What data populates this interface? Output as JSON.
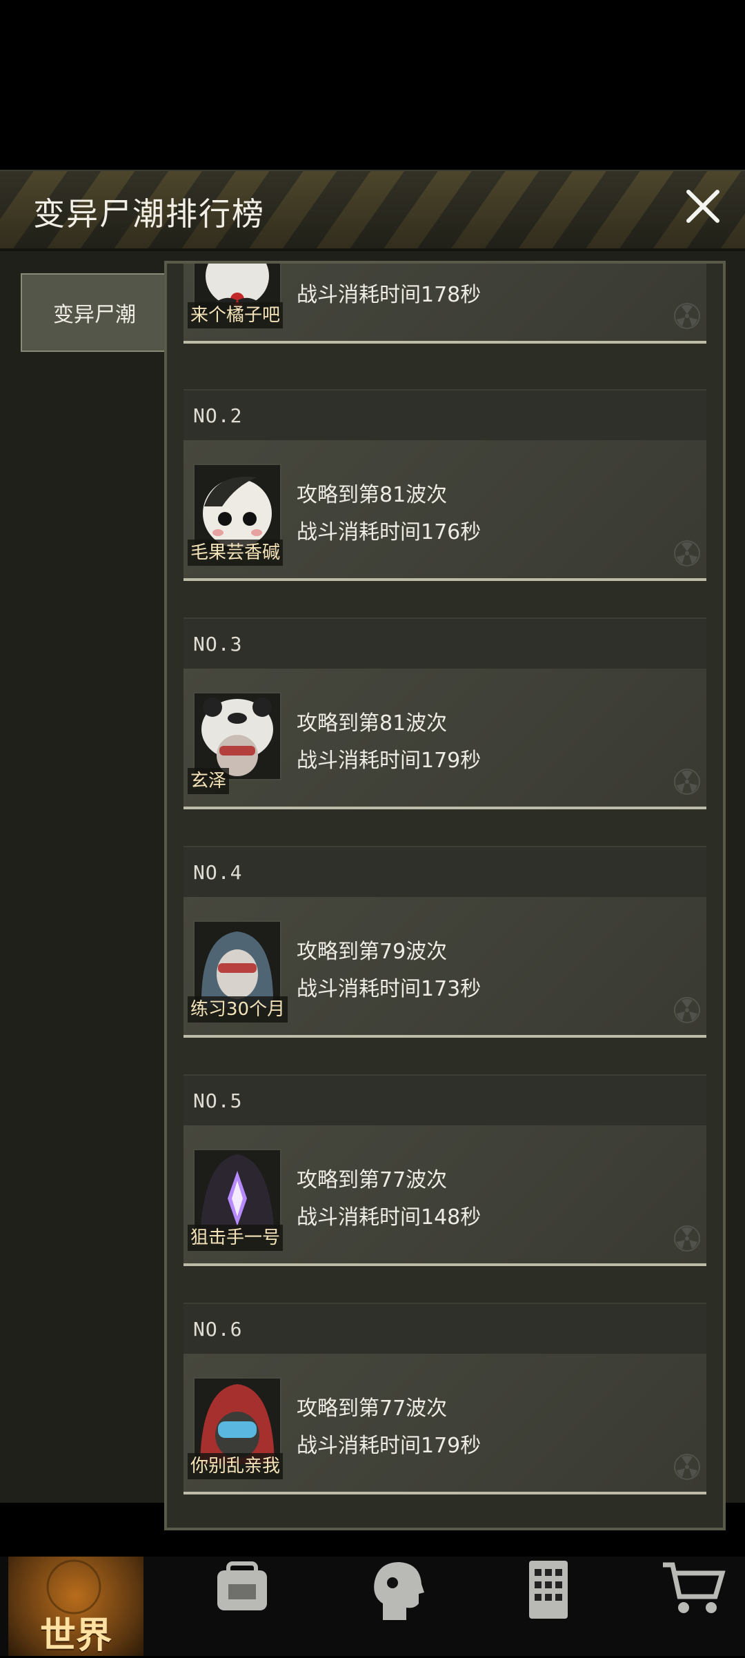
{
  "dialog": {
    "title": "变异尸潮排行榜",
    "close_icon": "close-icon"
  },
  "sidebar": {
    "tabs": [
      {
        "label": "变异尸潮"
      }
    ]
  },
  "leaderboard": {
    "partial_top": {
      "player": "来个橘子吧",
      "time_text": "战斗消耗时间178秒"
    },
    "entries": [
      {
        "rank": "NO.2",
        "player": "毛果芸香碱",
        "wave_text": "攻略到第81波次",
        "time_text": "战斗消耗时间176秒"
      },
      {
        "rank": "NO.3",
        "player": "玄泽",
        "wave_text": "攻略到第81波次",
        "time_text": "战斗消耗时间179秒"
      },
      {
        "rank": "NO.4",
        "player": "练习30个月",
        "wave_text": "攻略到第79波次",
        "time_text": "战斗消耗时间173秒"
      },
      {
        "rank": "NO.5",
        "player": "狙击手一号",
        "wave_text": "攻略到第77波次",
        "time_text": "战斗消耗时间148秒"
      },
      {
        "rank": "NO.6",
        "player": "你别乱亲我",
        "wave_text": "攻略到第77波次",
        "time_text": "战斗消耗时间179秒"
      }
    ]
  },
  "bottom_nav": {
    "world_label": "世界",
    "icons": [
      "backpack-icon",
      "character-head-icon",
      "building-icon",
      "cart-icon"
    ]
  }
}
